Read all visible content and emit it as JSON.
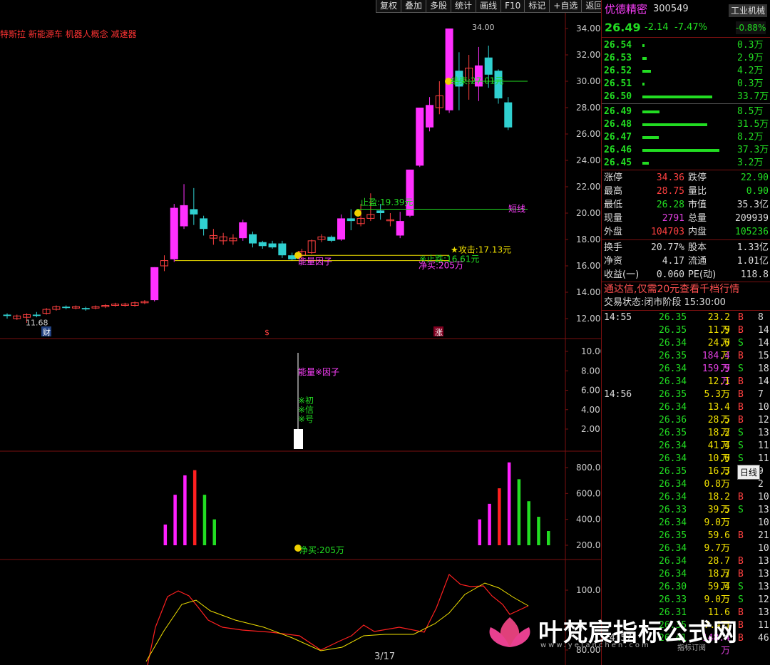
{
  "toolbar": {
    "items": [
      "复权",
      "叠加",
      "多股",
      "统计",
      "画线",
      "F10",
      "标记",
      "+自选",
      "返回"
    ]
  },
  "chart": {
    "concepts": "特斯拉 新能源车 机器人概念 减速器",
    "main_yaxis": [
      "34.00",
      "32.00",
      "30.00",
      "28.00",
      "26.00",
      "24.00",
      "22.00",
      "20.00",
      "18.00",
      "16.00",
      "14.00",
      "12.00"
    ],
    "vol_yaxis": [
      "10.00",
      "8.00",
      "6.00",
      "4.00",
      "2.00"
    ],
    "macd_yaxis": [
      "800.0",
      "600.0",
      "400.0",
      "200.0"
    ],
    "osc_yaxis": [
      "100.0",
      "80.00"
    ],
    "annotations": {
      "high_label": "34.00",
      "low_label": "11.68",
      "stop_profit": "止盈:19.39元",
      "end_label": "结束:27.01元",
      "short_line": "短线",
      "attack": "★攻击:17.13元",
      "stop_loss": "※止跌:16.61元",
      "energy": "能量因子",
      "net_buy": "净买:205万",
      "cai": "财",
      "s": "$",
      "zhang": "涨",
      "vol_energy": "能量※因子",
      "vol_signal": [
        "※初",
        "※信",
        "※号"
      ],
      "net_buy2": "净买:205万",
      "page": "3/17"
    },
    "candles": [
      {
        "o": 12.3,
        "c": 12.2,
        "h": 12.4,
        "l": 12.0
      },
      {
        "o": 12.0,
        "c": 12.2,
        "h": 12.3,
        "l": 11.9
      },
      {
        "o": 12.1,
        "c": 12.3,
        "h": 12.4,
        "l": 11.68
      },
      {
        "o": 12.3,
        "c": 12.2,
        "h": 12.5,
        "l": 12.1
      },
      {
        "o": 12.4,
        "c": 12.7,
        "h": 12.8,
        "l": 12.3
      },
      {
        "o": 12.7,
        "c": 12.9,
        "h": 13.0,
        "l": 12.6
      },
      {
        "o": 12.9,
        "c": 12.8,
        "h": 13.0,
        "l": 12.7
      },
      {
        "o": 12.8,
        "c": 12.9,
        "h": 13.0,
        "l": 12.7
      },
      {
        "o": 12.8,
        "c": 12.7,
        "h": 12.9,
        "l": 12.6
      },
      {
        "o": 12.8,
        "c": 12.9,
        "h": 13.0,
        "l": 12.7
      },
      {
        "o": 12.9,
        "c": 13.0,
        "h": 13.1,
        "l": 12.8
      },
      {
        "o": 13.0,
        "c": 13.1,
        "h": 13.2,
        "l": 12.9
      },
      {
        "o": 13.0,
        "c": 13.1,
        "h": 13.2,
        "l": 12.9
      },
      {
        "o": 13.0,
        "c": 13.2,
        "h": 13.3,
        "l": 12.9
      },
      {
        "o": 13.2,
        "c": 13.3,
        "h": 13.4,
        "l": 13.1
      },
      {
        "o": 13.4,
        "c": 15.9,
        "h": 15.9,
        "l": 13.3
      },
      {
        "o": 16.0,
        "c": 16.4,
        "h": 16.8,
        "l": 15.6
      },
      {
        "o": 16.5,
        "c": 20.4,
        "h": 20.7,
        "l": 16.3
      },
      {
        "o": 19.0,
        "c": 20.6,
        "h": 22.2,
        "l": 18.8
      },
      {
        "o": 20.3,
        "c": 19.9,
        "h": 21.9,
        "l": 19.1
      },
      {
        "o": 19.6,
        "c": 18.8,
        "h": 19.8,
        "l": 18.3
      },
      {
        "o": 18.1,
        "c": 18.3,
        "h": 18.8,
        "l": 17.6
      },
      {
        "o": 17.9,
        "c": 18.2,
        "h": 18.5,
        "l": 17.6
      },
      {
        "o": 17.9,
        "c": 18.1,
        "h": 18.4,
        "l": 17.6
      },
      {
        "o": 18.1,
        "c": 19.3,
        "h": 19.5,
        "l": 17.9
      },
      {
        "o": 18.4,
        "c": 17.7,
        "h": 18.6,
        "l": 17.4
      },
      {
        "o": 17.8,
        "c": 17.5,
        "h": 17.9,
        "l": 17.3
      },
      {
        "o": 17.7,
        "c": 17.4,
        "h": 17.9,
        "l": 17.3
      },
      {
        "o": 17.7,
        "c": 16.8,
        "h": 17.9,
        "l": 16.6
      },
      {
        "o": 16.8,
        "c": 16.5,
        "h": 17.0,
        "l": 16.4
      },
      {
        "o": 16.8,
        "c": 17.1,
        "h": 17.3,
        "l": 16.5
      },
      {
        "o": 17.0,
        "c": 17.9,
        "h": 18.0,
        "l": 16.9
      },
      {
        "o": 18.0,
        "c": 18.2,
        "h": 18.4,
        "l": 17.8
      },
      {
        "o": 18.2,
        "c": 17.9,
        "h": 18.3,
        "l": 17.8
      },
      {
        "o": 18.0,
        "c": 19.6,
        "h": 19.9,
        "l": 17.9
      },
      {
        "o": 19.6,
        "c": 19.4,
        "h": 20.3,
        "l": 18.7
      },
      {
        "o": 19.2,
        "c": 19.6,
        "h": 20.7,
        "l": 19.0
      },
      {
        "o": 19.6,
        "c": 19.9,
        "h": 21.5,
        "l": 19.4
      },
      {
        "o": 20.2,
        "c": 20.0,
        "h": 20.7,
        "l": 19.5
      },
      {
        "o": 19.5,
        "c": 19.5,
        "h": 20.0,
        "l": 19.0
      },
      {
        "o": 18.3,
        "c": 19.4,
        "h": 20.1,
        "l": 18.1
      },
      {
        "o": 19.8,
        "c": 23.3,
        "h": 23.3,
        "l": 19.7
      },
      {
        "o": 23.6,
        "c": 28.0,
        "h": 28.0,
        "l": 23.5
      },
      {
        "o": 26.5,
        "c": 28.2,
        "h": 28.8,
        "l": 26.2
      },
      {
        "o": 28.0,
        "c": 28.9,
        "h": 30.0,
        "l": 27.5
      },
      {
        "o": 27.8,
        "c": 34.0,
        "h": 34.0,
        "l": 27.6
      },
      {
        "o": 30.8,
        "c": 29.6,
        "h": 32.2,
        "l": 27.8
      },
      {
        "o": 30.0,
        "c": 31.0,
        "h": 32.0,
        "l": 28.6
      },
      {
        "o": 29.6,
        "c": 31.2,
        "h": 32.6,
        "l": 28.5
      },
      {
        "o": 31.8,
        "c": 30.5,
        "h": 32.7,
        "l": 29.5
      },
      {
        "o": 30.8,
        "c": 28.7,
        "h": 30.9,
        "l": 28.3
      },
      {
        "o": 28.4,
        "c": 26.5,
        "h": 28.8,
        "l": 26.3
      }
    ],
    "macd_bars": [
      {
        "v": 40,
        "c": "#ff2020"
      },
      {
        "v": 70,
        "c": "#ff2020"
      },
      {
        "v": 80,
        "c": "#ff2020"
      },
      {
        "v": 90,
        "c": "#22dd22"
      },
      {
        "v": 75,
        "c": "#22dd22"
      },
      {
        "v": 55,
        "c": "#22dd22"
      },
      {
        "v": 50,
        "c": "#22dd22"
      },
      {
        "v": 50,
        "c": "#22dd22"
      },
      {
        "v": 50,
        "c": "#ff2020"
      },
      {
        "v": 60,
        "c": "#ff2020"
      },
      {
        "v": 160,
        "c": "#ff20ff"
      },
      {
        "v": 360,
        "c": "#ff20ff"
      },
      {
        "v": 590,
        "c": "#ff20ff"
      },
      {
        "v": 740,
        "c": "#ff20ff"
      },
      {
        "v": 780,
        "c": "#ff2020"
      },
      {
        "v": 590,
        "c": "#22dd22"
      },
      {
        "v": 400,
        "c": "#22dd22"
      },
      {
        "v": 170,
        "c": "#22dd22"
      },
      {
        "v": 20,
        "c": "#22dd22"
      },
      {
        "v": 0,
        "c": "#22dd22"
      },
      {
        "v": 0,
        "c": "#22dd22"
      },
      {
        "v": 0,
        "c": "#22dd22"
      },
      {
        "v": 0,
        "c": "#22dd22"
      },
      {
        "v": 0,
        "c": "#22dd22"
      },
      {
        "v": 0,
        "c": "#22dd22"
      },
      {
        "v": 0,
        "c": "#22dd22"
      },
      {
        "v": 0,
        "c": "#22dd22"
      },
      {
        "v": 0,
        "c": "#22dd22"
      },
      {
        "v": 0,
        "c": "#22dd22"
      },
      {
        "v": 0,
        "c": "#22dd22"
      },
      {
        "v": 0,
        "c": "#22dd22"
      },
      {
        "v": 0,
        "c": "#22dd22"
      },
      {
        "v": 0,
        "c": "#22dd22"
      },
      {
        "v": 0,
        "c": "#22dd22"
      },
      {
        "v": 40,
        "c": "#ff20ff"
      },
      {
        "v": 110,
        "c": "#ff20ff"
      },
      {
        "v": 160,
        "c": "#ff20ff"
      },
      {
        "v": 150,
        "c": "#22dd22"
      },
      {
        "v": 180,
        "c": "#22dd22"
      },
      {
        "v": 190,
        "c": "#ff2020"
      },
      {
        "v": 140,
        "c": "#ff2020"
      },
      {
        "v": 130,
        "c": "#22dd22"
      },
      {
        "v": 180,
        "c": "#ff20ff"
      },
      {
        "v": 400,
        "c": "#ff20ff"
      },
      {
        "v": 520,
        "c": "#ff20ff"
      },
      {
        "v": 640,
        "c": "#ff2020"
      },
      {
        "v": 840,
        "c": "#ff20ff"
      },
      {
        "v": 710,
        "c": "#22dd22"
      },
      {
        "v": 540,
        "c": "#22dd22"
      },
      {
        "v": 420,
        "c": "#22dd22"
      },
      {
        "v": 310,
        "c": "#22dd22"
      },
      {
        "v": 90,
        "c": "#22dd22"
      }
    ]
  },
  "panel": {
    "name": "优德精密",
    "code": "300549",
    "industry": "工业机械",
    "industry_chg": "-0.88%",
    "price": "26.49",
    "change": "-2.14",
    "change_pct": "-7.47%",
    "asks": [
      {
        "p": "26.54",
        "v": "0.3万",
        "w": 3
      },
      {
        "p": "26.53",
        "v": "2.9万",
        "w": 6
      },
      {
        "p": "26.52",
        "v": "4.2万",
        "w": 12
      },
      {
        "p": "26.51",
        "v": "0.3万",
        "w": 3
      },
      {
        "p": "26.50",
        "v": "33.7万",
        "w": 98
      }
    ],
    "bids": [
      {
        "p": "26.49",
        "v": "8.5万",
        "w": 24
      },
      {
        "p": "26.48",
        "v": "31.5万",
        "w": 91
      },
      {
        "p": "26.47",
        "v": "8.2万",
        "w": 23
      },
      {
        "p": "26.46",
        "v": "37.3万",
        "w": 108
      },
      {
        "p": "26.45",
        "v": "3.2万",
        "w": 9
      }
    ],
    "stats": [
      {
        "l1": "涨停",
        "v1": "34.36",
        "c1": "red",
        "l2": "跌停",
        "v2": "22.90",
        "c2": "green"
      },
      {
        "l1": "最高",
        "v1": "28.75",
        "c1": "red",
        "l2": "量比",
        "v2": "0.90",
        "c2": "green"
      },
      {
        "l1": "最低",
        "v1": "26.28",
        "c1": "green",
        "l2": "市值",
        "v2": "35.3亿",
        "c2": "white"
      },
      {
        "l1": "现量",
        "v1": "2791",
        "c1": "magenta",
        "l2": "总量",
        "v2": "209939",
        "c2": "white"
      },
      {
        "l1": "外盘",
        "v1": "104703",
        "c1": "red",
        "l2": "内盘",
        "v2": "105236",
        "c2": "green"
      }
    ],
    "stats2": [
      {
        "l1": "换手",
        "v1": "20.77%",
        "l2": "股本",
        "v2": "1.33亿"
      },
      {
        "l1": "净资",
        "v1": "4.17",
        "l2": "流通",
        "v2": "1.01亿"
      },
      {
        "l1": "收益(一)",
        "v1": "0.060",
        "l2": "PE(动)",
        "v2": "118.8"
      }
    ],
    "promo": "通达信,仅需20元查看千档行情",
    "trade_state": "交易状态:闭市阶段 15:30:00",
    "ticks": [
      {
        "t": "14:55",
        "p": "26.35",
        "v": "23.2万",
        "s": "B",
        "n": "8"
      },
      {
        "t": "",
        "p": "26.35",
        "v": "11.9万",
        "s": "B",
        "n": "14"
      },
      {
        "t": "",
        "p": "26.34",
        "v": "24.0万",
        "s": "S",
        "n": "14"
      },
      {
        "t": "",
        "p": "26.35",
        "v": "184.4万",
        "s": "B",
        "n": "15"
      },
      {
        "t": "",
        "p": "26.34",
        "v": "159.9万",
        "s": "S",
        "n": "18"
      },
      {
        "t": "",
        "p": "26.34",
        "v": "12.1万",
        "s": "B",
        "n": "14"
      },
      {
        "t": "14:56",
        "p": "26.35",
        "v": "5.3万",
        "s": "B",
        "n": "7"
      },
      {
        "t": "",
        "p": "26.34",
        "v": "13.4万",
        "s": "B",
        "n": "10"
      },
      {
        "t": "",
        "p": "26.36",
        "v": "28.5万",
        "s": "B",
        "n": "12"
      },
      {
        "t": "",
        "p": "26.35",
        "v": "18.2万",
        "s": "S",
        "n": "13"
      },
      {
        "t": "",
        "p": "26.34",
        "v": "41.4万",
        "s": "S",
        "n": "11"
      },
      {
        "t": "",
        "p": "26.34",
        "v": "10.0万",
        "s": "S",
        "n": "11"
      },
      {
        "t": "",
        "p": "26.35",
        "v": "16.3万",
        "s": "B",
        "n": "9"
      },
      {
        "t": "",
        "p": "26.34",
        "v": "0.8万",
        "s": "",
        "n": "2"
      },
      {
        "t": "",
        "p": "26.34",
        "v": "18.2万",
        "s": "B",
        "n": "10"
      },
      {
        "t": "",
        "p": "26.33",
        "v": "39.5万",
        "s": "S",
        "n": "13"
      },
      {
        "t": "",
        "p": "26.34",
        "v": "9.0万",
        "s": "",
        "n": "10"
      },
      {
        "t": "",
        "p": "26.35",
        "v": "59.6万",
        "s": "B",
        "n": "21"
      },
      {
        "t": "",
        "p": "26.34",
        "v": "9.7万",
        "s": "",
        "n": "10"
      },
      {
        "t": "",
        "p": "26.34",
        "v": "28.7万",
        "s": "B",
        "n": "13"
      },
      {
        "t": "",
        "p": "26.34",
        "v": "18.7万",
        "s": "B",
        "n": "13"
      },
      {
        "t": "",
        "p": "26.30",
        "v": "59.4万",
        "s": "S",
        "n": "13"
      },
      {
        "t": "",
        "p": "26.33",
        "v": "9.0万",
        "s": "S",
        "n": "12"
      },
      {
        "t": "",
        "p": "26.31",
        "v": "11.6万",
        "s": "B",
        "n": "13"
      },
      {
        "t": "",
        "p": "26.35",
        "v": "7.4万",
        "s": "B",
        "n": "11"
      },
      {
        "t": "14:57",
        "p": "26.41",
        "v": "148.4万",
        "s": "B",
        "n": "46"
      }
    ],
    "tooltip": "日线"
  },
  "watermark": {
    "title": "叶梵宸指标公式网",
    "url": "www.yefanchen.com",
    "sub": "指标订阅"
  }
}
